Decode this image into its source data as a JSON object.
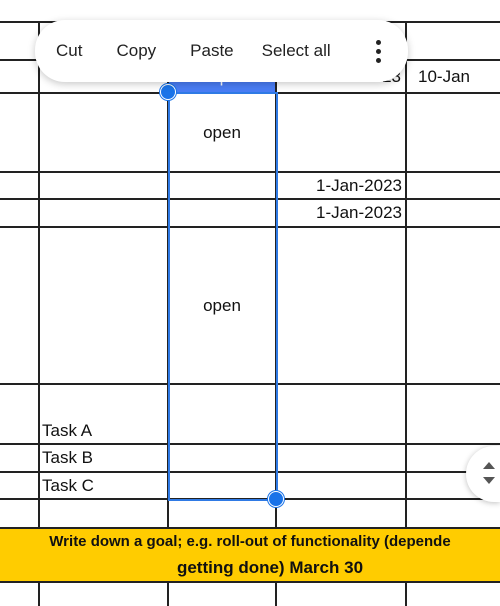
{
  "context_menu": {
    "items": [
      {
        "label": "Cut"
      },
      {
        "label": "Copy"
      },
      {
        "label": "Paste"
      },
      {
        "label": "Select all"
      }
    ],
    "more_icon": "more-vertical-icon"
  },
  "cells": {
    "status_complete": "complete",
    "date_row1": "1-Jan-2023",
    "date_row1_col4": "10-Jan",
    "status_open_1": "open",
    "date_row3": "1-Jan-2023",
    "date_row4": "1-Jan-2023",
    "status_open_2": "open",
    "task_a": "Task A",
    "task_b": "Task B",
    "task_c": "Task C"
  },
  "banner": {
    "line1": "Write down a goal; e.g. roll-out of functionality (depende",
    "line2": "getting done) March 30"
  },
  "colors": {
    "selection": "#2f7ae5",
    "complete_fill": "#4a7df5",
    "banner": "#ffcc00"
  },
  "scroll_icon": "scroll-up-down-icon"
}
